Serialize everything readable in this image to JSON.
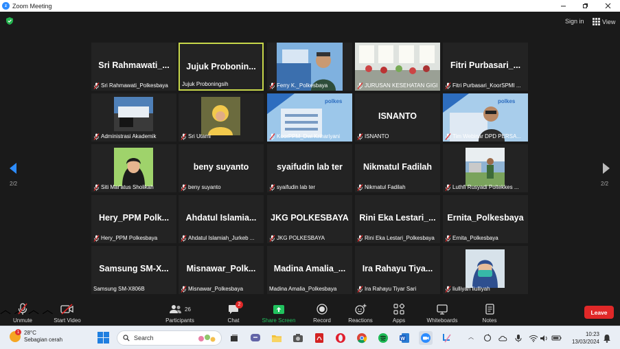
{
  "window": {
    "title": "Zoom Meeting"
  },
  "header": {
    "sign_in": "Sign in",
    "view": "View"
  },
  "pager": {
    "left": "2/2",
    "right": "2/2"
  },
  "tiles": [
    {
      "big": "Sri  Rahmawati_...",
      "label": "Sri Rahmawati_Polkesbaya",
      "muted": true,
      "video": false
    },
    {
      "big": "Jujuk  Probonin...",
      "label": "Jujuk Proboningsih",
      "muted": false,
      "video": false,
      "active": true
    },
    {
      "big": "",
      "label": "Ferry K._Polkesbaya",
      "muted": true,
      "video": true
    },
    {
      "big": "",
      "label": "JURUSAN KESEHATAN GIGI",
      "muted": true,
      "video": true
    },
    {
      "big": "Fitri  Purbasari_...",
      "label": "Fitri Purbasari_KoorSPMI ...",
      "muted": true,
      "video": false
    },
    {
      "big": "",
      "label": "Administrasi Akademik",
      "muted": true,
      "video": true
    },
    {
      "big": "",
      "label": "Sri Utami",
      "muted": true,
      "video": true
    },
    {
      "big": "",
      "label": "KoorPPM_Dwi Krihariyani",
      "muted": true,
      "video": true
    },
    {
      "big": "ISNANTO",
      "label": "ISNANTO",
      "muted": true,
      "video": false
    },
    {
      "big": "",
      "label": "Tim Webinar DPD PERSA...",
      "muted": true,
      "video": true
    },
    {
      "big": "",
      "label": "Siti Mar'atus Sholikah",
      "muted": true,
      "video": true
    },
    {
      "big": "beny suyanto",
      "label": "beny suyanto",
      "muted": true,
      "video": false
    },
    {
      "big": "syaifudin lab ter",
      "label": "syaifudin lab ter",
      "muted": true,
      "video": false
    },
    {
      "big": "Nikmatul Fadilah",
      "label": "Nikmatul Fadilah",
      "muted": true,
      "video": false
    },
    {
      "big": "",
      "label": "Luthfi Rusyadi Poltekkes ...",
      "muted": true,
      "video": true
    },
    {
      "big": "Hery_PPM  Polk...",
      "label": "Hery_PPM Polkesbaya",
      "muted": true,
      "video": false
    },
    {
      "big": "Ahdatul  Islamia...",
      "label": "Ahdatul Islamiah_Jurkeb ...",
      "muted": true,
      "video": false
    },
    {
      "big": "JKG POLKESBAYA",
      "label": "JKG POLKESBAYA",
      "muted": true,
      "video": false
    },
    {
      "big": "Rini Eka Lestari_...",
      "label": "Rini Eka Lestari_Polkesbaya",
      "muted": true,
      "video": false
    },
    {
      "big": "Ernita_Polkesbaya",
      "label": "Ernita_Polkesbaya",
      "muted": true,
      "video": false
    },
    {
      "big": "Samsung  SM-X...",
      "label": "Samsung SM-X806B",
      "muted": false,
      "video": false
    },
    {
      "big": "Misnawar_Polk...",
      "label": "Misnawar_Polkesbaya",
      "muted": true,
      "video": false
    },
    {
      "big": "Madina  Amalia_...",
      "label": "Madina Amalia_Polkesbaya",
      "muted": false,
      "video": false
    },
    {
      "big": "Ira  Rahayu  Tiya...",
      "label": "Ira Rahayu Tiyar Sari",
      "muted": true,
      "video": false
    },
    {
      "big": "",
      "label": "liulliyah liulliyah",
      "muted": true,
      "video": true
    }
  ],
  "toolbar": {
    "unmute": "Unmute",
    "start_video": "Start Video",
    "participants": "Participants",
    "participants_count": "26",
    "chat": "Chat",
    "chat_badge": "2",
    "share_screen": "Share Screen",
    "record": "Record",
    "reactions": "Reactions",
    "apps": "Apps",
    "whiteboards": "Whiteboards",
    "notes": "Notes",
    "leave": "Leave"
  },
  "taskbar": {
    "weather_temp": "28°C",
    "weather_desc": "Sebagian cerah",
    "weather_badge": "1",
    "search_placeholder": "Search",
    "time": "10:23",
    "date": "13/03/2024"
  },
  "colors": {
    "accent_zoom": "#2d8cff",
    "active_speaker": "#c8d84a",
    "leave": "#e02828",
    "share_green": "#21c25e"
  }
}
